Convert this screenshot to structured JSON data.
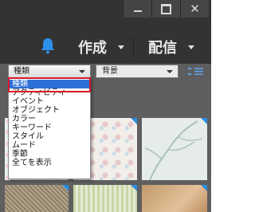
{
  "window": {
    "minimize_icon": "minimize-icon",
    "maximize_icon": "maximize-icon",
    "close_glyph": "✕"
  },
  "header": {
    "notification_icon": "bell-icon",
    "create_label": "作成",
    "publish_label": "配信",
    "accent_color": "#2b8be0"
  },
  "filter": {
    "type_select_value": "種類",
    "background_select_value": "背景",
    "sort_icon": "sort-list-icon"
  },
  "dropdown": {
    "options": [
      "種類",
      "アクティビティ",
      "イベント",
      "オブジェクト",
      "カラー",
      "キーワード",
      "スタイル",
      "ムード",
      "季節",
      "全てを表示"
    ],
    "selected_index": 0,
    "selection_color": "#2e6fd6",
    "highlight_color": "#d9182a"
  }
}
